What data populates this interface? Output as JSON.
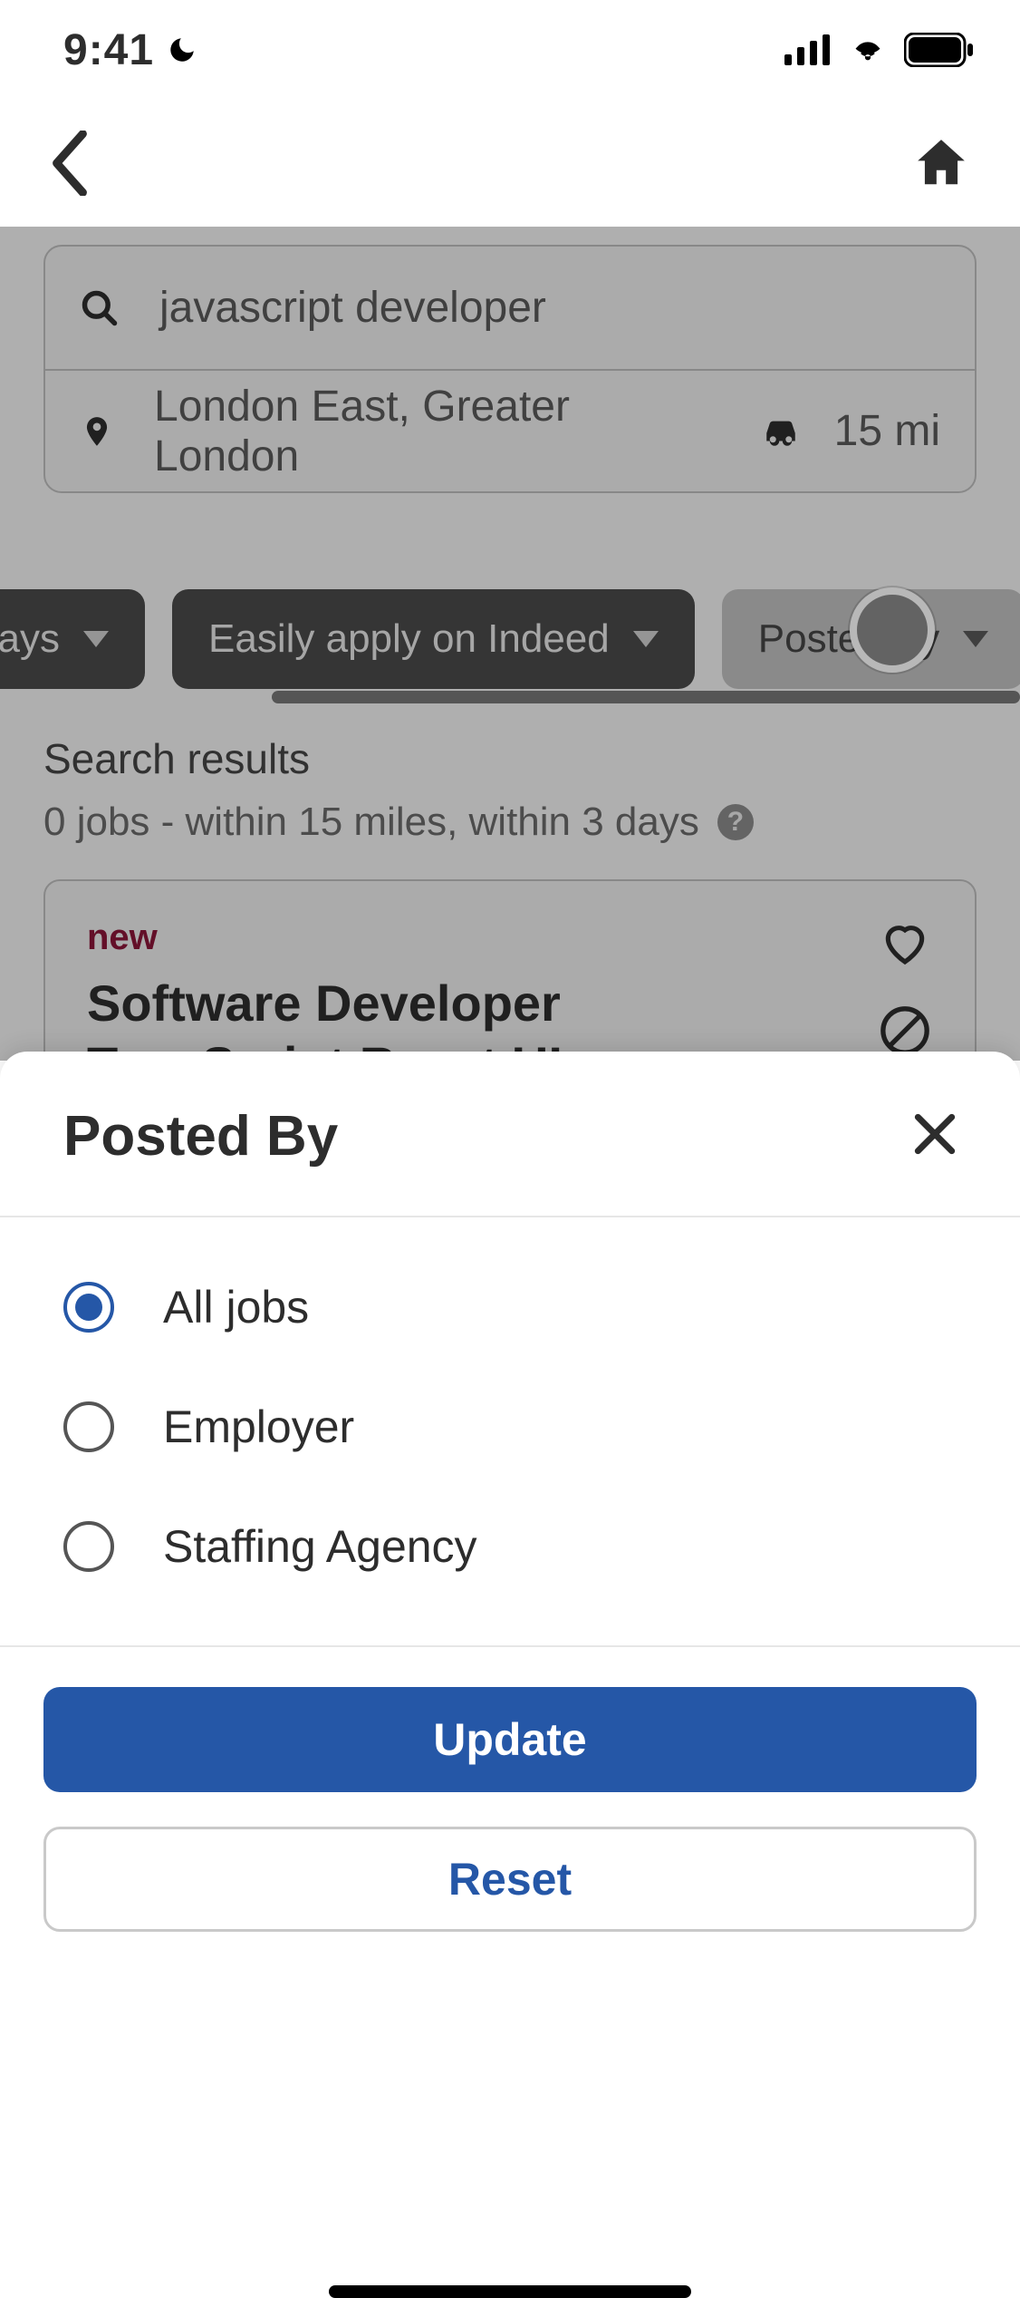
{
  "status": {
    "time": "9:41"
  },
  "search": {
    "query": "javascript developer",
    "location": "London East, Greater London",
    "distance": "15 mi"
  },
  "filters": {
    "chips": [
      {
        "label": "ays",
        "style": "dark1"
      },
      {
        "label": "Easily apply on Indeed",
        "style": "dark"
      },
      {
        "label": "Posted By",
        "style": "light"
      }
    ]
  },
  "results": {
    "heading": "Search results",
    "summary": "0 jobs - within 15 miles, within 3 days"
  },
  "job": {
    "badge": "new",
    "title": "Software Developer TypeScript React UI - Remote"
  },
  "sheet": {
    "title": "Posted By",
    "options": [
      {
        "label": "All jobs",
        "selected": true
      },
      {
        "label": "Employer",
        "selected": false
      },
      {
        "label": "Staffing Agency",
        "selected": false
      }
    ],
    "update_label": "Update",
    "reset_label": "Reset"
  }
}
